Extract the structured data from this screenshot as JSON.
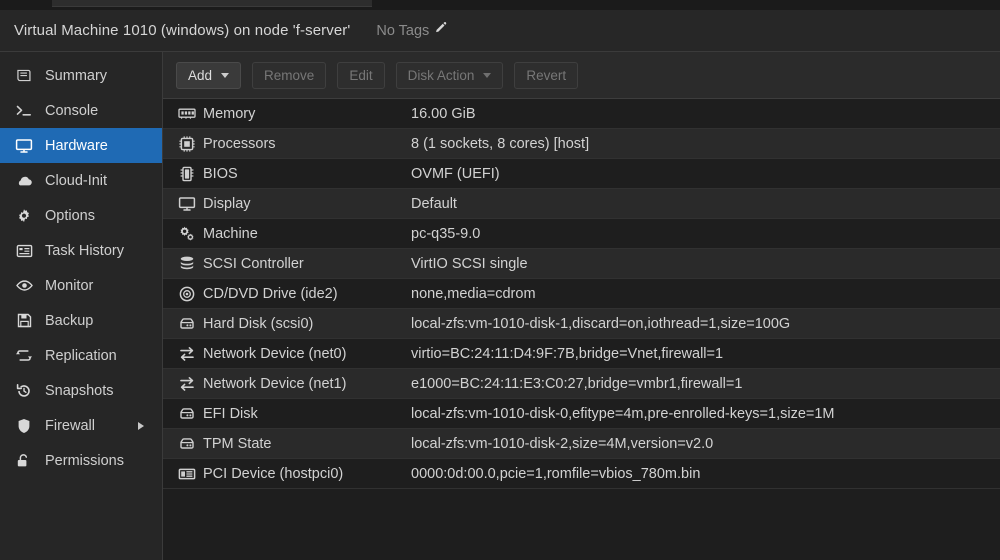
{
  "header": {
    "title": "Virtual Machine 1010 (windows) on node 'f-server'",
    "tags_label": "No Tags",
    "tags_edit_icon": "pencil-icon"
  },
  "sidebar": {
    "items": [
      {
        "label": "Summary",
        "icon": "summary-icon",
        "selected": false,
        "submenu": false
      },
      {
        "label": "Console",
        "icon": "console-icon",
        "selected": false,
        "submenu": false
      },
      {
        "label": "Hardware",
        "icon": "hardware-icon",
        "selected": true,
        "submenu": false
      },
      {
        "label": "Cloud-Init",
        "icon": "cloud-icon",
        "selected": false,
        "submenu": false
      },
      {
        "label": "Options",
        "icon": "gear-icon",
        "selected": false,
        "submenu": false
      },
      {
        "label": "Task History",
        "icon": "task-history-icon",
        "selected": false,
        "submenu": false
      },
      {
        "label": "Monitor",
        "icon": "eye-icon",
        "selected": false,
        "submenu": false
      },
      {
        "label": "Backup",
        "icon": "floppy-icon",
        "selected": false,
        "submenu": false
      },
      {
        "label": "Replication",
        "icon": "replication-icon",
        "selected": false,
        "submenu": false
      },
      {
        "label": "Snapshots",
        "icon": "history-icon",
        "selected": false,
        "submenu": false
      },
      {
        "label": "Firewall",
        "icon": "shield-icon",
        "selected": false,
        "submenu": true
      },
      {
        "label": "Permissions",
        "icon": "unlock-icon",
        "selected": false,
        "submenu": false
      }
    ]
  },
  "toolbar": {
    "buttons": [
      {
        "label": "Add",
        "caret": true,
        "disabled": false
      },
      {
        "label": "Remove",
        "caret": false,
        "disabled": true
      },
      {
        "label": "Edit",
        "caret": false,
        "disabled": true
      },
      {
        "label": "Disk Action",
        "caret": true,
        "disabled": true
      },
      {
        "label": "Revert",
        "caret": false,
        "disabled": true
      }
    ]
  },
  "hardware": {
    "rows": [
      {
        "icon": "memory-icon",
        "key": "Memory",
        "value": "16.00 GiB"
      },
      {
        "icon": "cpu-icon",
        "key": "Processors",
        "value": "8 (1 sockets, 8 cores) [host]"
      },
      {
        "icon": "bios-icon",
        "key": "BIOS",
        "value": "OVMF (UEFI)"
      },
      {
        "icon": "display-icon",
        "key": "Display",
        "value": "Default"
      },
      {
        "icon": "gears-icon",
        "key": "Machine",
        "value": "pc-q35-9.0"
      },
      {
        "icon": "database-icon",
        "key": "SCSI Controller",
        "value": "VirtIO SCSI single"
      },
      {
        "icon": "cdrom-icon",
        "key": "CD/DVD Drive (ide2)",
        "value": "none,media=cdrom"
      },
      {
        "icon": "harddisk-icon",
        "key": "Hard Disk (scsi0)",
        "value": "local-zfs:vm-1010-disk-1,discard=on,iothread=1,size=100G"
      },
      {
        "icon": "network-icon",
        "key": "Network Device (net0)",
        "value": "virtio=BC:24:11:D4:9F:7B,bridge=Vnet,firewall=1"
      },
      {
        "icon": "network-icon",
        "key": "Network Device (net1)",
        "value": "e1000=BC:24:11:E3:C0:27,bridge=vmbr1,firewall=1"
      },
      {
        "icon": "harddisk-icon",
        "key": "EFI Disk",
        "value": "local-zfs:vm-1010-disk-0,efitype=4m,pre-enrolled-keys=1,size=1M"
      },
      {
        "icon": "harddisk-icon",
        "key": "TPM State",
        "value": "local-zfs:vm-1010-disk-2,size=4M,version=v2.0"
      },
      {
        "icon": "pci-icon",
        "key": "PCI Device (hostpci0)",
        "value": "0000:0d:00.0,pcie=1,romfile=vbios_780m.bin"
      }
    ]
  },
  "colors": {
    "accent": "#1f6ab4",
    "background": "#1e1e1e",
    "sidebar_background": "#262626",
    "header_background": "#272727",
    "row_alt": "#2a2a2a",
    "text": "#d2d2d2",
    "text_muted": "#8b8b8b"
  }
}
